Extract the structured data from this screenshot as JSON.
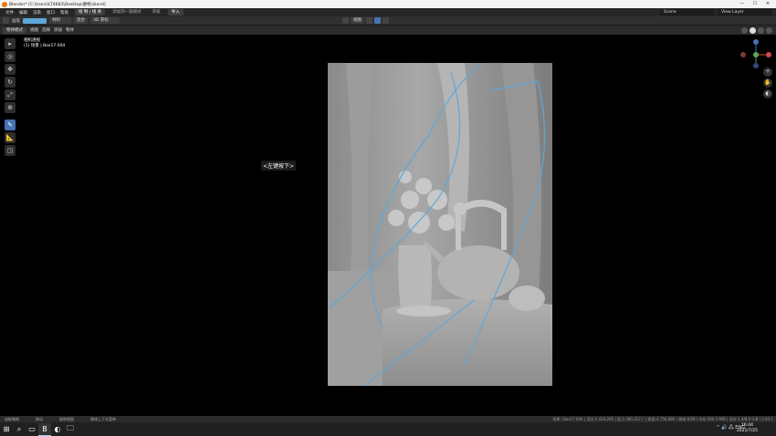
{
  "titlebar": {
    "title": "Blender* [C:\\Users\\LT4683\\Desktop\\静物.blend]",
    "min": "—",
    "max": "☐",
    "close": "✕"
  },
  "menubar": {
    "items": [
      "文件",
      "编辑",
      "渲染",
      "窗口",
      "帮助"
    ],
    "tabs": [
      "绘 制 / 线 条",
      "添加到一般模式",
      "审核",
      "导入"
    ],
    "scene_label": "Scene",
    "view_layer_label": "View Layer"
  },
  "toolbar": {
    "brush_label": "画笔",
    "dd_mode": "材料",
    "dd_blend": "混合",
    "dd_placement": "3D 游标",
    "view_btn": "视图",
    "overlay_label": "叠加"
  },
  "header2": {
    "mode": "物体模式",
    "menus": [
      "视图",
      "选择",
      "添加",
      "物体"
    ]
  },
  "viewport": {
    "cam_title": "相机透视",
    "cam_obj": "(1) 场景 | Box17.004",
    "hint": "<左键按下>"
  },
  "left_tools": [
    "▸",
    "◎",
    "✥",
    "↻",
    "⤢",
    "⊕",
    "✎",
    "📐",
    "◳"
  ],
  "statusbar": {
    "left": [
      "选取笔刷",
      "移动",
      "旋转视图",
      "物体上下文菜单"
    ],
    "right": "场景 | Box17.004 | 顶点:2,434,295 | 面:2,380,312 | 三角面:4,756,680 | 物体:0/28 | 内存:300.5 MiB | 显存:1.4/8.0 GiB | 2.93.1"
  },
  "taskbar": {
    "apps": [
      "⊞",
      "⌕",
      "▭",
      "B",
      "◐",
      "🗀"
    ],
    "tray": "^  🔊  🖧  ENG",
    "time": "16:44",
    "date": "2021/7/25"
  },
  "colors": {
    "accent": "#4772b3",
    "stroke": "#5fa7d9"
  }
}
